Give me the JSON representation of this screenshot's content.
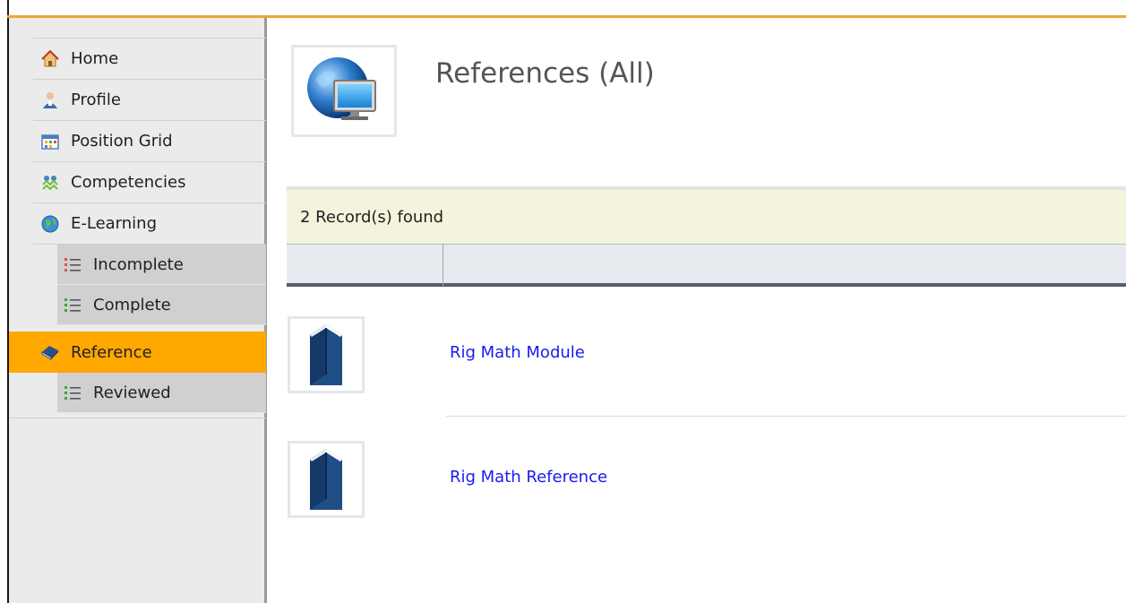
{
  "sidebar": {
    "items": [
      {
        "label": "Home",
        "icon": "home-icon"
      },
      {
        "label": "Profile",
        "icon": "profile-icon"
      },
      {
        "label": "Position Grid",
        "icon": "grid-icon"
      },
      {
        "label": "Competencies",
        "icon": "competencies-icon"
      },
      {
        "label": "E-Learning",
        "icon": "globe-icon"
      }
    ],
    "elearning_sub": [
      {
        "label": "Incomplete",
        "icon": "list-red-icon"
      },
      {
        "label": "Complete",
        "icon": "list-green-icon"
      }
    ],
    "reference": {
      "label": "Reference",
      "icon": "book-icon"
    },
    "reference_sub": [
      {
        "label": "Reviewed",
        "icon": "list-green-icon"
      }
    ]
  },
  "main": {
    "title": "References (All)",
    "records_found": "2 Record(s) found",
    "rows": [
      {
        "title": "Rig Math Module"
      },
      {
        "title": "Rig Math Reference"
      }
    ]
  },
  "colors": {
    "active": "#ffa800",
    "accent_line": "#f2a23c",
    "link": "#1a1af0",
    "records_bar": "#f4f4dd"
  }
}
